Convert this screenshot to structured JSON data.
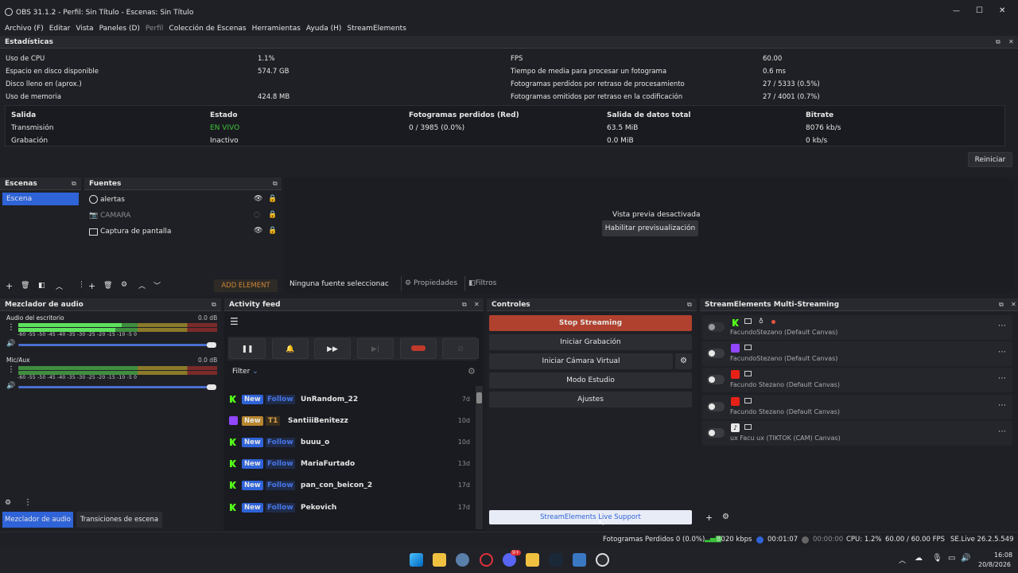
{
  "window": {
    "title": "OBS 31.1.2 - Perfil: Sin Título - Escenas: Sin Título",
    "minimize": "—",
    "maximize": "☐",
    "close": "✕"
  },
  "menu": [
    "Archivo (F)",
    "Editar",
    "Vista",
    "Paneles (D)",
    "Perfil",
    "Colección de Escenas",
    "Herramientas",
    "Ayuda (H)",
    "StreamElements"
  ],
  "stats": {
    "title": "Estadísticas",
    "left": [
      {
        "label": "Uso de CPU",
        "value": "1.1%"
      },
      {
        "label": "Espacio en disco disponible",
        "value": "574.7 GB"
      },
      {
        "label": "Disco lleno en (aprox.)",
        "value": ""
      },
      {
        "label": "Uso de memoria",
        "value": "424.8 MB"
      }
    ],
    "right": [
      {
        "label": "FPS",
        "value": "60.00"
      },
      {
        "label": "Tiempo de media para procesar un fotograma",
        "value": "0.6 ms"
      },
      {
        "label": "Fotogramas perdidos por retraso de procesamiento",
        "value": "27 / 5333 (0.5%)"
      },
      {
        "label": "Fotogramas omitidos por retraso en la codificación",
        "value": "27 / 4001 (0.7%)"
      }
    ],
    "table": {
      "headers": [
        "Salida",
        "Estado",
        "Fotogramas perdidos (Red)",
        "Salida de datos total",
        "Bitrate"
      ],
      "rows": [
        [
          "Transmisión",
          "EN VIVO",
          "0 / 3985 (0.0%)",
          "63.5 MiB",
          "8076 kb/s"
        ],
        [
          "Grabación",
          "Inactivo",
          "",
          "0.0 MiB",
          "0 kb/s"
        ]
      ]
    },
    "reset": "Reiniciar"
  },
  "scenes": {
    "title": "Escenas",
    "items": [
      "Escena"
    ]
  },
  "sources": {
    "title": "Fuentes",
    "items": [
      "alertas",
      "CAMARA",
      "Captura de pantalla"
    ],
    "add_element": "ADD ELEMENT"
  },
  "preview": {
    "disabled": "Vista previa desactivada",
    "enable": "Habilitar previsualización",
    "no_source": "Ninguna fuente seleccionac",
    "properties": "Propiedades",
    "filters": "Filtros"
  },
  "mixer": {
    "title": "Mezclador de audio",
    "channels": [
      {
        "name": "Audio del escritorio",
        "db": "0.0 dB"
      },
      {
        "name": "Mic/Aux",
        "db": "0.0 dB"
      }
    ],
    "ticks": "-60  -55  -50  -45  -40  -35  -30  -25  -20  -15  -10   -5    0",
    "tab_mixer": "Mezclador de audio",
    "tab_transitions": "Transiciones de escena"
  },
  "feed": {
    "title": "Activity feed",
    "filter": "Filter",
    "rows": [
      {
        "platform": "kick",
        "badge1": "New",
        "badge2": "Follow",
        "name": "UnRandom_22",
        "time": "7d"
      },
      {
        "platform": "twitch",
        "badge1": "New",
        "badge2": "T1",
        "name": "SantiiiBenitezz",
        "time": "10d"
      },
      {
        "platform": "kick",
        "badge1": "New",
        "badge2": "Follow",
        "name": "buuu_o",
        "time": "10d"
      },
      {
        "platform": "kick",
        "badge1": "New",
        "badge2": "Follow",
        "name": "MariaFurtado",
        "time": "13d"
      },
      {
        "platform": "kick",
        "badge1": "New",
        "badge2": "Follow",
        "name": "pan_con_beicon_2",
        "time": "17d"
      },
      {
        "platform": "kick",
        "badge1": "New",
        "badge2": "Follow",
        "name": "Pekovich",
        "time": "17d"
      }
    ]
  },
  "controls": {
    "title": "Controles",
    "stop": "Stop Streaming",
    "record": "Iniciar Grabación",
    "vcam": "Iniciar Cámara Virtual",
    "studio": "Modo Estudio",
    "settings": "Ajustes",
    "support": "StreamElements Live Support"
  },
  "multi": {
    "title": "StreamElements Multi-Streaming",
    "rows": [
      {
        "platform": "kick",
        "sub": "FacundoStezano (Default Canvas)",
        "color": "#53fc18"
      },
      {
        "platform": "twitch",
        "sub": "FacundoStezano (Default Canvas)",
        "color": "#9146ff"
      },
      {
        "platform": "youtube",
        "sub": "Facundo Stezano (Default Canvas)",
        "color": "#e62117"
      },
      {
        "platform": "youtube",
        "sub": "Facundo Stezano (Default Canvas)",
        "color": "#e62117"
      },
      {
        "platform": "tiktok",
        "sub": "ux Facu ux (TIKTOK (CAM) Canvas)",
        "color": "#111111"
      }
    ]
  },
  "status": {
    "dropped": "Fotogramas Perdidos 0 (0.0%)",
    "kbps": "8020 kbps",
    "live_time": "00:01:07",
    "rec_time": "00:00:00",
    "cpu": "CPU: 1.2%",
    "fps": "60.00 / 60.00 FPS",
    "se": "SE.Live 26.2.5.549"
  },
  "taskbar": {
    "time": "16:08",
    "date": "20/8/2026",
    "badge": "9+"
  },
  "colors": {
    "accent": "#2f63d8",
    "live": "#3cc43c",
    "stop": "#b0412e",
    "new_badge": "#2f63d8",
    "follow": "#4876e6",
    "t1": "#b8862e"
  }
}
